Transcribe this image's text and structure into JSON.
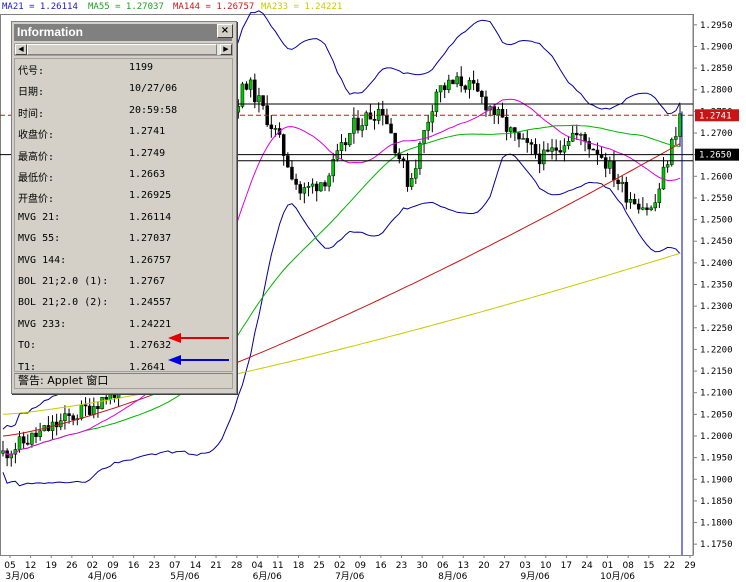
{
  "legend": [
    {
      "label": "MA21 = 1.26114",
      "color": "#1a1ac8"
    },
    {
      "label": "MA55 = 1.27037",
      "color": "#1fa01f"
    },
    {
      "label": "MA144 = 1.26757",
      "color": "#c81a1a"
    },
    {
      "label": "MA233 = 1.24221",
      "color": "#c8c800"
    }
  ],
  "info": {
    "title": "Information",
    "close": "×",
    "scroll_left": "◀",
    "scroll_right": "▶",
    "rows": [
      {
        "k": "代号:",
        "v": "1199"
      },
      {
        "k": "日期:",
        "v": "10/27/06"
      },
      {
        "k": "时间:",
        "v": "20:59:58"
      },
      {
        "k": "收盘价:",
        "v": "1.2741"
      },
      {
        "k": "最高价:",
        "v": "1.2749"
      },
      {
        "k": "最低价:",
        "v": "1.2663"
      },
      {
        "k": "开盘价:",
        "v": "1.26925"
      },
      {
        "k": "MVG 21:",
        "v": "1.26114"
      },
      {
        "k": "MVG 55:",
        "v": "1.27037"
      },
      {
        "k": "MVG 144:",
        "v": "1.26757"
      },
      {
        "k": "BOL 21;2.0 (1):",
        "v": "1.2767"
      },
      {
        "k": "BOL 21;2.0 (2):",
        "v": "1.24557"
      },
      {
        "k": "MVG 233:",
        "v": "1.24221"
      },
      {
        "k": "TO:",
        "v": "1.27632"
      },
      {
        "k": "T1:",
        "v": "1.2641"
      }
    ],
    "status": "警告: Applet 窗口"
  },
  "colors": {
    "candle_up": "#00c800",
    "candle_down": "#000000",
    "ma21": "#e000e0",
    "ma55": "#00b400",
    "ma144": "#c81414",
    "ma233": "#c8c800",
    "bollinger": "#0000a0",
    "level_line": "#000000",
    "dashed_level": "#c81414",
    "price_label_bg": "#c81414",
    "arrow_red": "#e00000",
    "arrow_blue": "#0000e0"
  },
  "chart_data": {
    "type": "candlestick",
    "symbol": "1199",
    "current_price": "1.2741",
    "marked_price": "1.2650",
    "ylim": [
      1.1725,
      1.2975
    ],
    "y_ticks": [
      "1.2950",
      "1.2900",
      "1.2850",
      "1.2800",
      "1.2750",
      "1.2700",
      "1.2650",
      "1.2600",
      "1.2550",
      "1.2500",
      "1.2450",
      "1.2400",
      "1.2350",
      "1.2300",
      "1.2250",
      "1.2200",
      "1.2150",
      "1.2100",
      "1.2050",
      "1.2000",
      "1.1950",
      "1.1900",
      "1.1850",
      "1.1800",
      "1.1750"
    ],
    "x_day_ticks": [
      "05",
      "12",
      "19",
      "26",
      "02",
      "09",
      "16",
      "23",
      "07",
      "14",
      "21",
      "28",
      "04",
      "11",
      "18",
      "25",
      "02",
      "09",
      "16",
      "23",
      "30",
      "06",
      "13",
      "20",
      "27",
      "03",
      "10",
      "17",
      "24",
      "01",
      "08",
      "15",
      "22",
      "29"
    ],
    "x_month_ticks": [
      "3月/06",
      "4月/06",
      "5月/06",
      "6月/06",
      "7月/06",
      "8月/06",
      "9月/06",
      "10月/06"
    ],
    "horizontal_levels": [
      1.2767,
      1.2741,
      1.265,
      1.2636
    ],
    "moving_averages": {
      "MA21": 1.26114,
      "MA55": 1.27037,
      "MA144": 1.26757,
      "MA233": 1.24221
    },
    "bollinger": {
      "upper": 1.2767,
      "lower": 1.24557
    },
    "targets": {
      "TO": 1.27632,
      "T1": 1.2641
    },
    "last_bar": {
      "date": "10/27/06",
      "time": "20:59:58",
      "open": 1.26925,
      "high": 1.2749,
      "low": 1.2663,
      "close": 1.2741
    }
  }
}
